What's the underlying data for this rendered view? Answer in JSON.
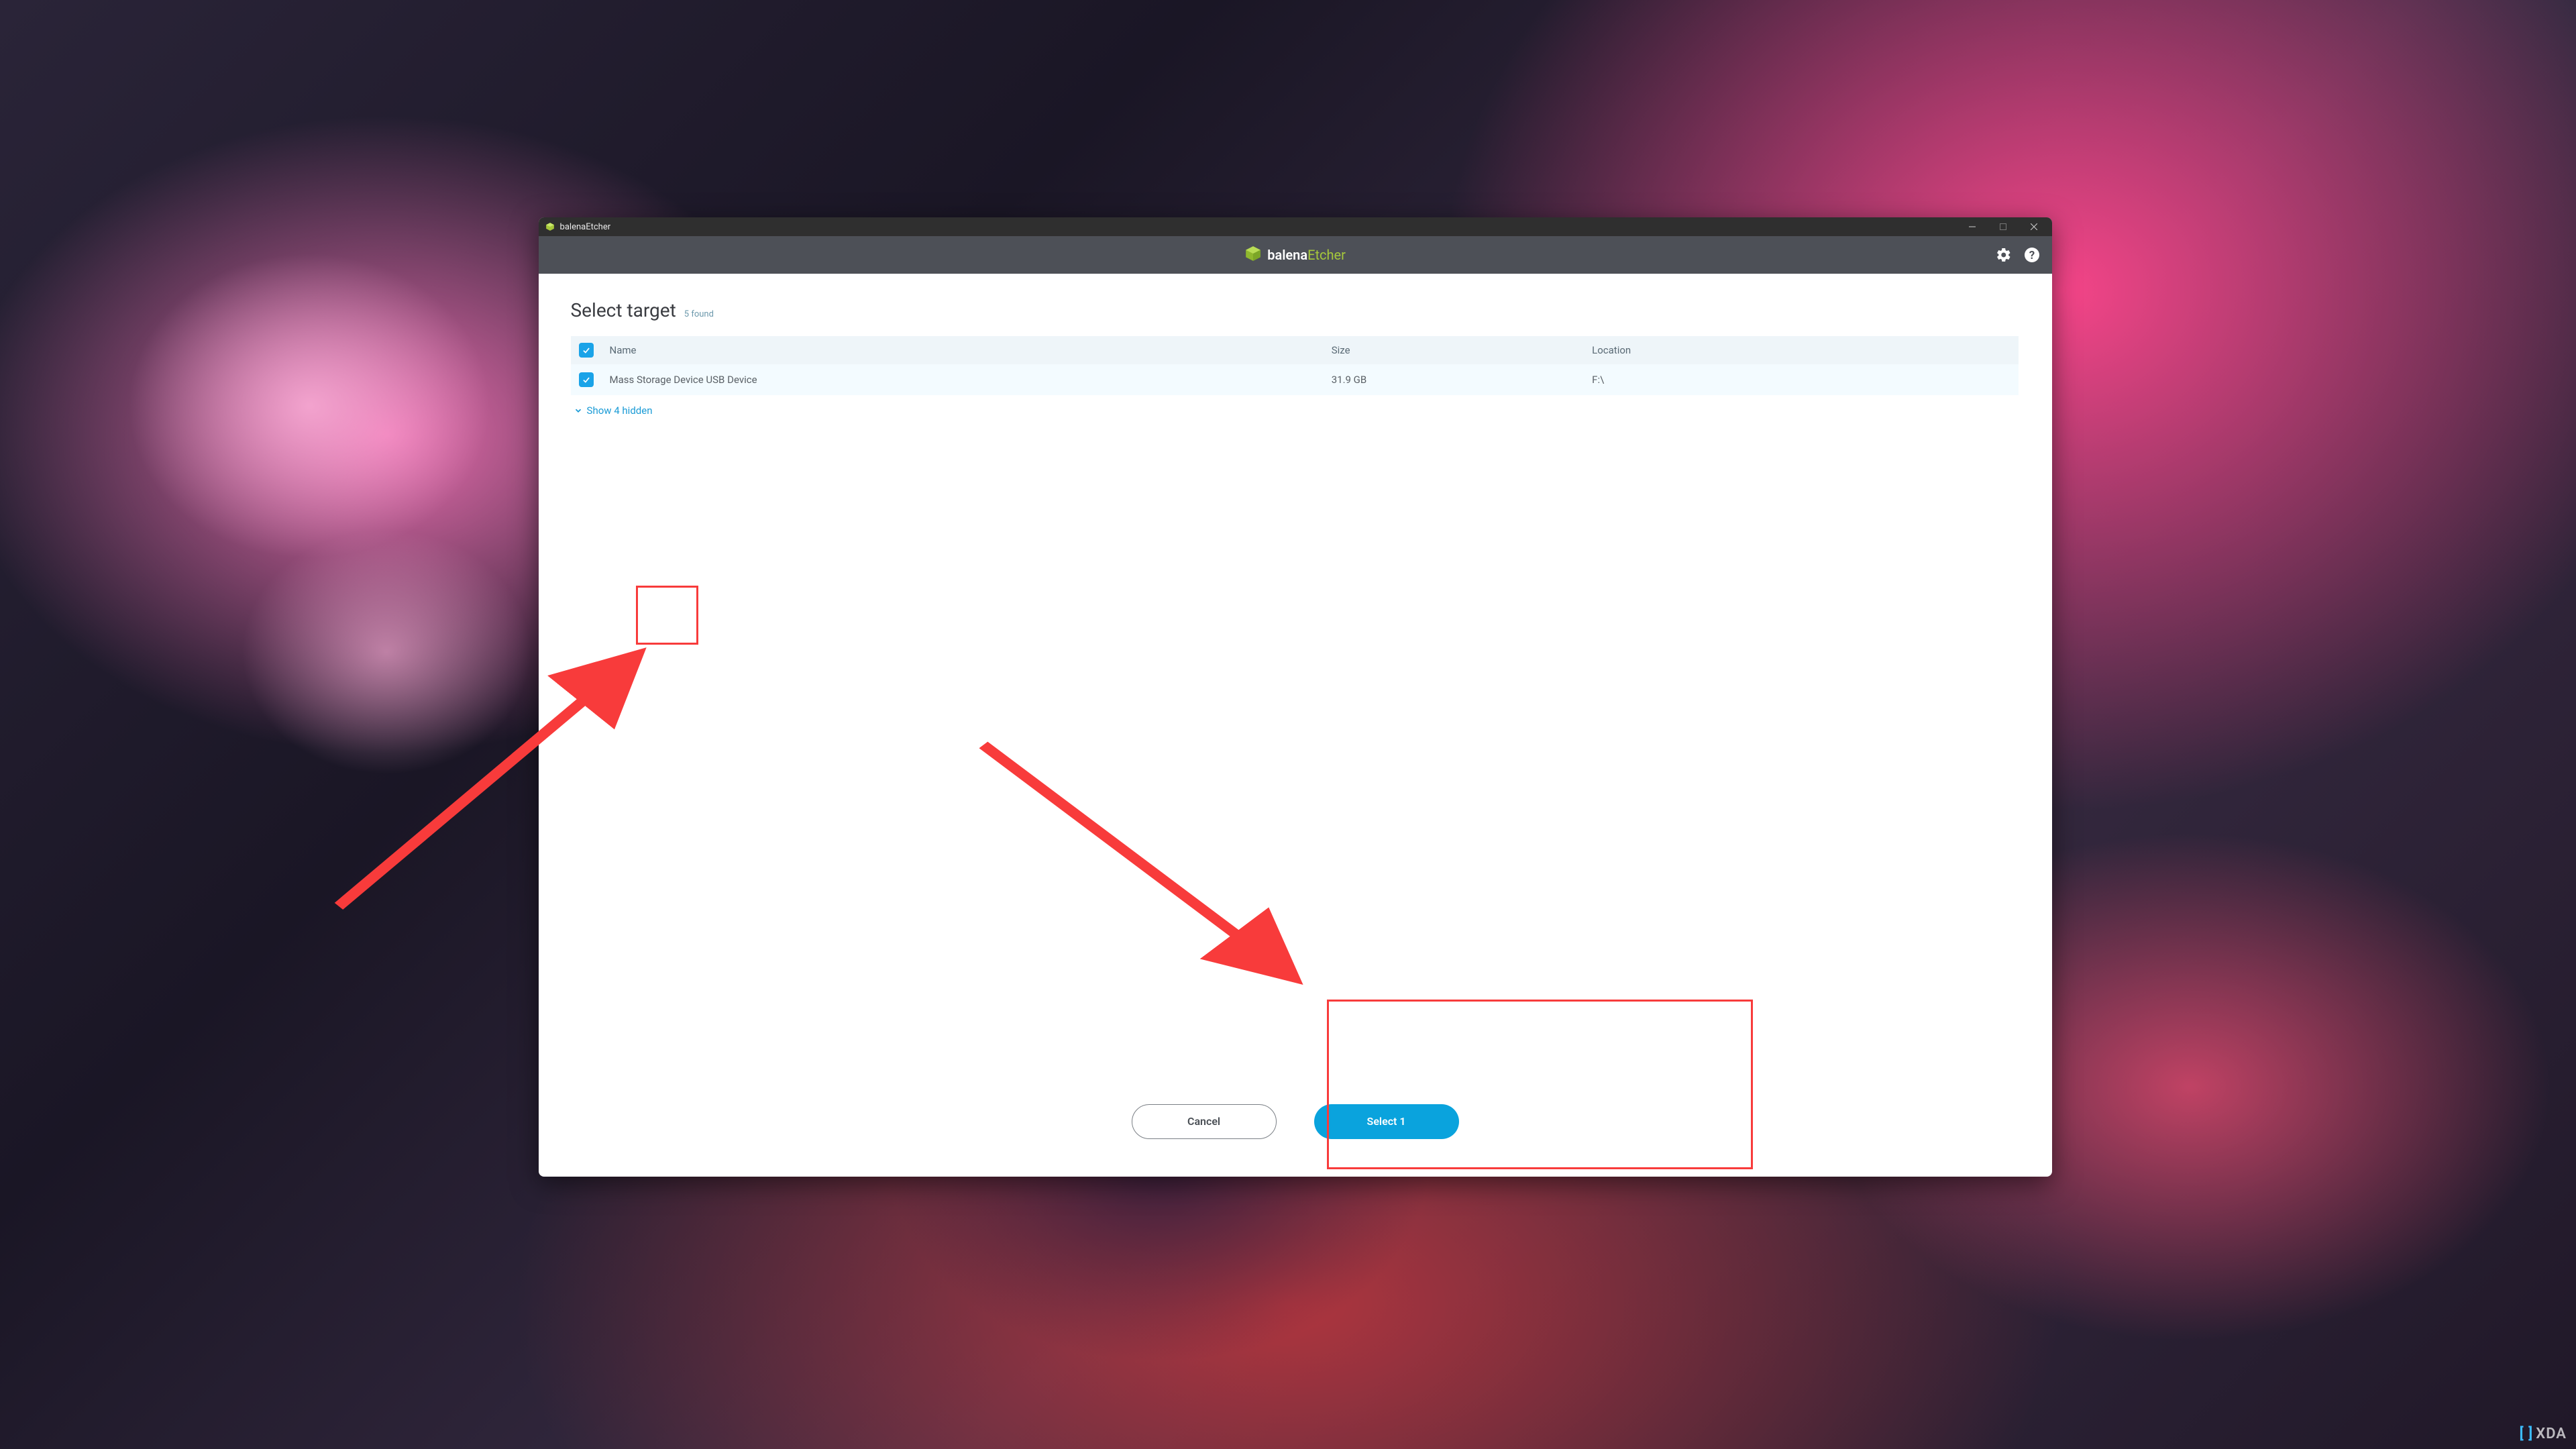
{
  "window": {
    "title": "balenaEtcher",
    "brand_prefix": "balena",
    "brand_suffix": "Etcher"
  },
  "panel": {
    "heading": "Select target",
    "found_text": "5 found",
    "columns": {
      "name": "Name",
      "size": "Size",
      "location": "Location"
    },
    "rows": [
      {
        "name": "Mass Storage Device USB Device",
        "size": "31.9 GB",
        "location": "F:\\"
      }
    ],
    "show_hidden": "Show 4 hidden",
    "cancel": "Cancel",
    "select": "Select 1"
  },
  "watermark": "XDA"
}
